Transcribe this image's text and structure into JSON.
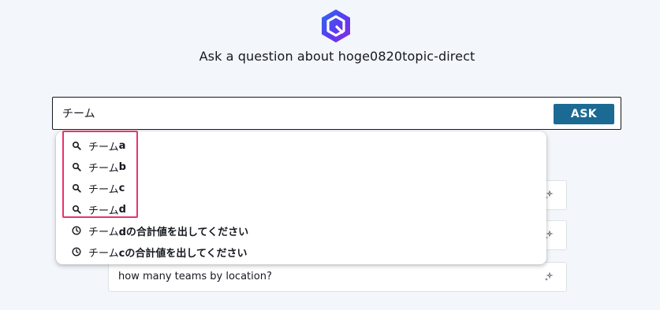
{
  "header": {
    "title": "Ask a question about hoge0820topic-direct"
  },
  "search": {
    "value": "チーム",
    "ask_label": "ASK"
  },
  "suggestions": [
    {
      "prefix": "チーム",
      "completion": "a",
      "icon": "search-icon"
    },
    {
      "prefix": "チーム",
      "completion": "b",
      "icon": "search-icon"
    },
    {
      "prefix": "チーム",
      "completion": "c",
      "icon": "search-icon"
    },
    {
      "prefix": "チーム",
      "completion": "d",
      "icon": "search-icon"
    }
  ],
  "history": [
    {
      "prefix": "チーム",
      "completion": "dの合計値を出してください",
      "icon": "clock-icon"
    },
    {
      "prefix": "チーム",
      "completion": "cの合計値を出してください",
      "icon": "clock-icon"
    }
  ],
  "suggested_questions": [
    {
      "text": ""
    },
    {
      "text": ""
    },
    {
      "text": "how many teams by location?"
    }
  ],
  "colors": {
    "accent": "#1b6a94",
    "highlight": "#e8336b",
    "background": "#f3f6fa"
  }
}
